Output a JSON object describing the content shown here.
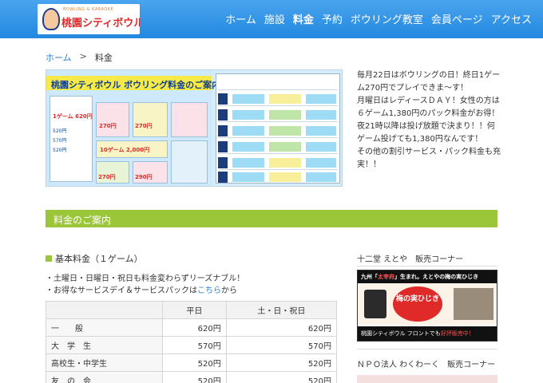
{
  "header": {
    "logo_sub": "BOWLING & KARAOKE",
    "logo_title": "桃園シティボウル",
    "nav": [
      "ホーム",
      "施設",
      "料金",
      "予約",
      "ボウリング教室",
      "会員ページ",
      "アクセス"
    ]
  },
  "breadcrumb": {
    "home": "ホーム",
    "sep": ">",
    "current": "料金"
  },
  "banner": {
    "title": "桃園シティボウル ボウリング料金のご案内",
    "price1": "1ゲーム 620円",
    "price2": "10ゲーム 2,000円",
    "price3": "1ゲーム 270円",
    "price4": "1ゲーム 290円"
  },
  "promo": {
    "lines": [
      "毎月22日はボウリングの日！終日1ゲーム270円でプレイできま〜す！",
      "月曜日はレディースＤＡＹ！女性の方は６ゲーム1,380円のパック料金がお得！",
      "夜21時以降は投げ放題で決まり！！何ゲーム投げても1,380円なんです！",
      "その他の割引サービス・パック料金も充実！！"
    ]
  },
  "section": {
    "title": "料金のご案内"
  },
  "basic": {
    "heading": "基本料金（１ゲーム）",
    "note1": "・土曜日・日曜日・祝日も料金変わらずリーズナブル！",
    "note2_prefix": "・お得なサービスデイ＆サービスパックは",
    "note2_link": "こちら",
    "note2_suffix": "から"
  },
  "fare_table": {
    "headers": [
      "",
      "平日",
      "土・日・祝日"
    ],
    "rows": [
      {
        "label": "一　　般",
        "weekday": "620円",
        "weekend": "620円"
      },
      {
        "label": "大　学　生",
        "weekday": "570円",
        "weekend": "570円"
      },
      {
        "label": "高校生・中学生",
        "weekday": "520円",
        "weekend": "520円"
      },
      {
        "label": "友　の　会",
        "weekday": "520円",
        "weekend": "520円"
      }
    ]
  },
  "sidebar": {
    "heading1": "十二堂 えとや　販売コーナー",
    "sp_top_prefix": "九州「",
    "sp_top_red": "太宰府",
    "sp_top_suffix": "」生まれ。えとやの梅の実ひじき",
    "sp_logo": "梅の実ひじき",
    "sp_bottom_prefix": "桃園シティボウル フロントでも",
    "sp_bottom_red": "好評販売中！",
    "heading2": "ＮＰＯ法人 わくわーく　販売コーナー"
  },
  "colors": {
    "header": "#2388de",
    "section_bar": "#9cc63a",
    "link": "#2a7fd0"
  }
}
